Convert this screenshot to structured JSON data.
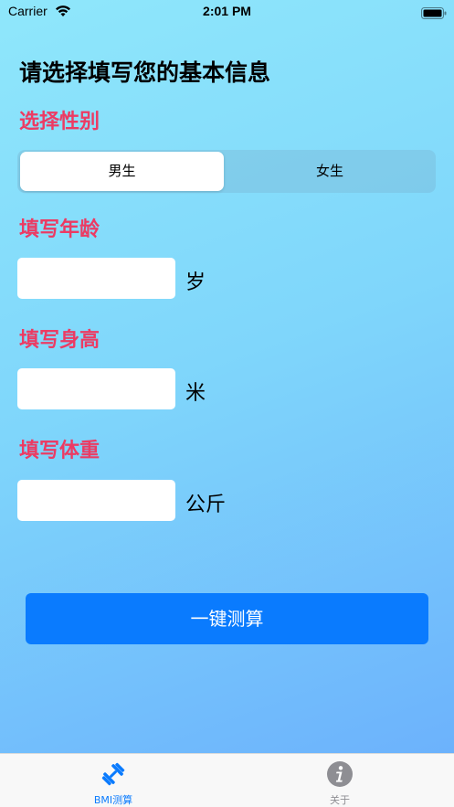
{
  "status_bar": {
    "carrier": "Carrier",
    "time": "2:01 PM"
  },
  "title": "请选择填写您的基本信息",
  "gender": {
    "label": "选择性别",
    "options": [
      "男生",
      "女生"
    ],
    "selected": "男生"
  },
  "age": {
    "label": "填写年龄",
    "value": "",
    "unit": "岁"
  },
  "height": {
    "label": "填写身高",
    "value": "",
    "unit": "米"
  },
  "weight": {
    "label": "填写体重",
    "value": "",
    "unit": "公斤"
  },
  "calculate_button": "一键测算",
  "tab_bar": {
    "tabs": [
      {
        "label": "BMI测算",
        "icon": "dumbbell-icon",
        "selected": true
      },
      {
        "label": "关于",
        "icon": "info-icon",
        "selected": false
      }
    ]
  },
  "colors": {
    "accent": "#0a7bfe",
    "section_label": "#ec3b63",
    "background_start": "#8fe7fb",
    "background_end": "#6aaefc"
  }
}
